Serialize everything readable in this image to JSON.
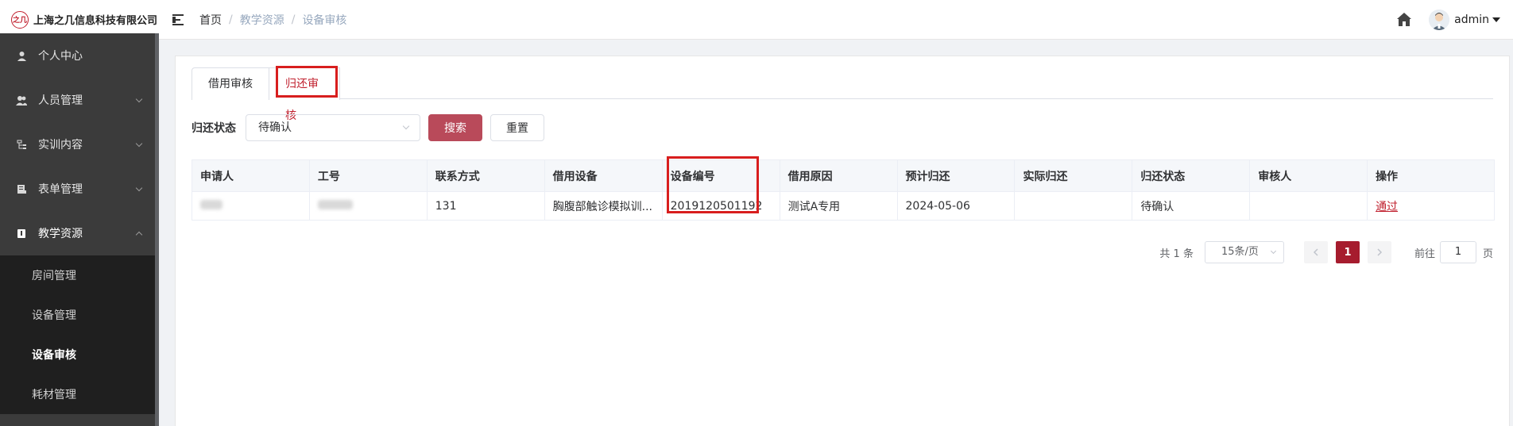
{
  "header": {
    "logo_mark": "之几",
    "company": "上海之几信息科技有限公司",
    "breadcrumb": [
      "首页",
      "教学资源",
      "设备审核"
    ],
    "user": "admin"
  },
  "sidebar": {
    "items": [
      {
        "label": "个人中心",
        "icon": "person-icon"
      },
      {
        "label": "人员管理",
        "icon": "people-icon"
      },
      {
        "label": "实训内容",
        "icon": "tree-icon"
      },
      {
        "label": "表单管理",
        "icon": "form-icon"
      },
      {
        "label": "教学资源",
        "icon": "book-icon"
      }
    ],
    "submenu": [
      "房间管理",
      "设备管理",
      "设备审核",
      "耗材管理"
    ],
    "active_sub": "设备审核"
  },
  "tabs": [
    "借用审核",
    "归还审核"
  ],
  "active_tab": "归还审核",
  "filter": {
    "label": "归还状态",
    "select_value": "待确认",
    "search_label": "搜索",
    "reset_label": "重置"
  },
  "table": {
    "headers": [
      "申请人",
      "工号",
      "联系方式",
      "借用设备",
      "设备编号",
      "借用原因",
      "预计归还",
      "实际归还",
      "归还状态",
      "审核人",
      "操作"
    ],
    "rows": [
      {
        "applicant": "",
        "staff_id": "",
        "contact": "131",
        "device": "胸腹部触诊模拟训...",
        "device_no": "2019120501192",
        "reason": "测试A专用",
        "expected_return": "2024-05-06",
        "actual_return": "",
        "status": "待确认",
        "reviewer": "",
        "action": "通过"
      }
    ]
  },
  "pagination": {
    "total": "共 1 条",
    "page_size": "15条/页",
    "current_page": "1",
    "goto_label": "前往",
    "goto_value": "1",
    "page_unit": "页"
  },
  "colors": {
    "accent": "#c0202e",
    "primary_button": "#b94a5a",
    "sidebar_bg": "#3b3b3b",
    "highlight_box": "#d81e1e"
  }
}
